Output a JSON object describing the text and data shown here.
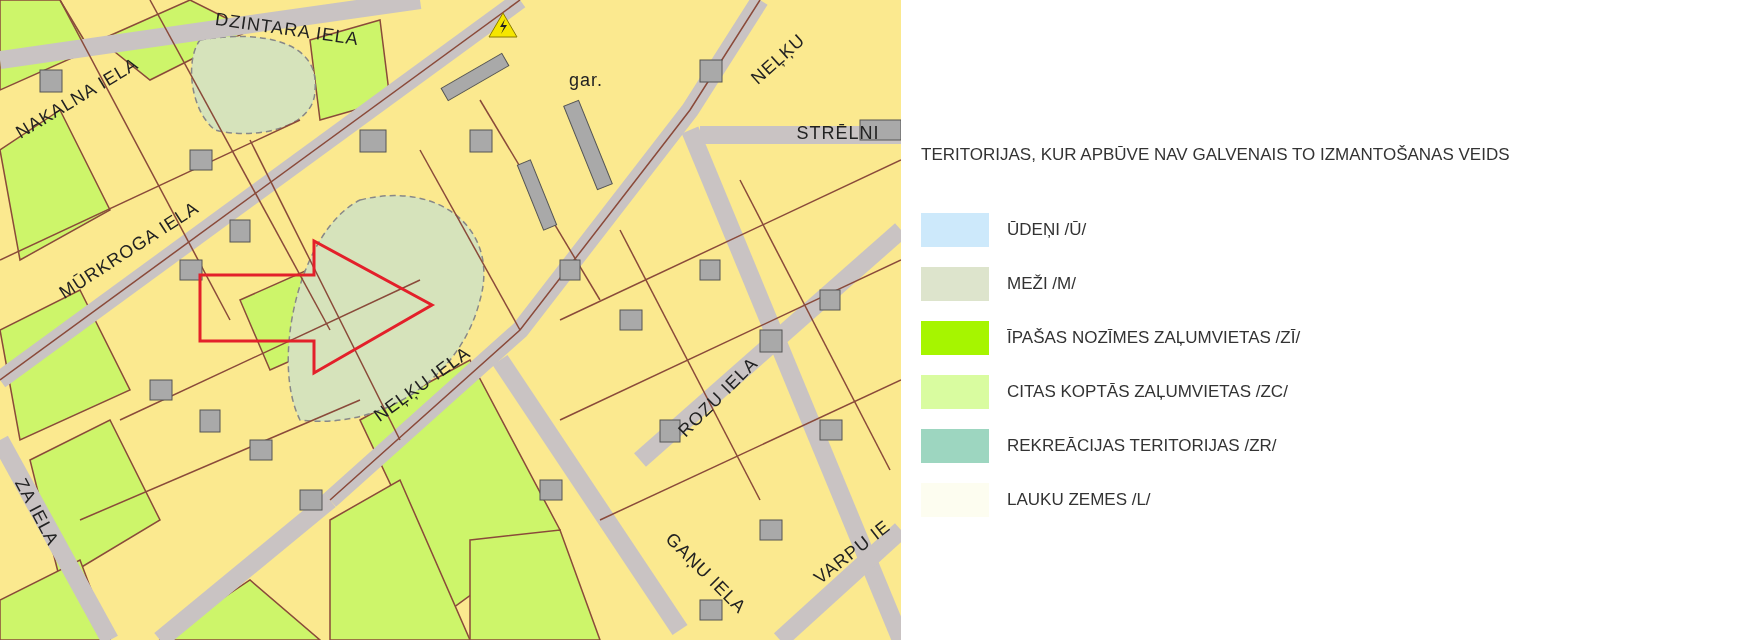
{
  "map": {
    "labels": [
      {
        "text": "DZINTARA IELA"
      },
      {
        "text": "NAKALNA IELA"
      },
      {
        "text": "MŪRKROGA IELA"
      },
      {
        "text": "NEĻĶU IELA"
      },
      {
        "text": "NEĻĶU"
      },
      {
        "text": "STRĒLNI"
      },
      {
        "text": "gar."
      },
      {
        "text": "ROZU IELA"
      },
      {
        "text": "GAŅU IELA"
      },
      {
        "text": "VARPU IE"
      },
      {
        "text": "ZA IELA"
      }
    ]
  },
  "legend": {
    "title": "TERITORIJAS, KUR  APBŪVE NAV GALVENAIS TO IZMANTOŠANAS VEIDS",
    "items": [
      {
        "label": "ŪDEŅI /Ū/",
        "color": "#cde9fb"
      },
      {
        "label": "MEŽI /M/",
        "color": "#dde4cc"
      },
      {
        "label": "ĪPAŠAS NOZĪMES ZAĻUMVIETAS /ZĪ/",
        "color": "#a6f500"
      },
      {
        "label": "CITAS KOPTĀS ZAĻUMVIETAS /ZC/",
        "color": "#d9fca0"
      },
      {
        "label": "REKREĀCIJAS TERITORIJAS /ZR/",
        "color": "#9dd6c0"
      },
      {
        "label": "LAUKU ZEMES /L/",
        "color": "#fdfdf0"
      }
    ]
  }
}
